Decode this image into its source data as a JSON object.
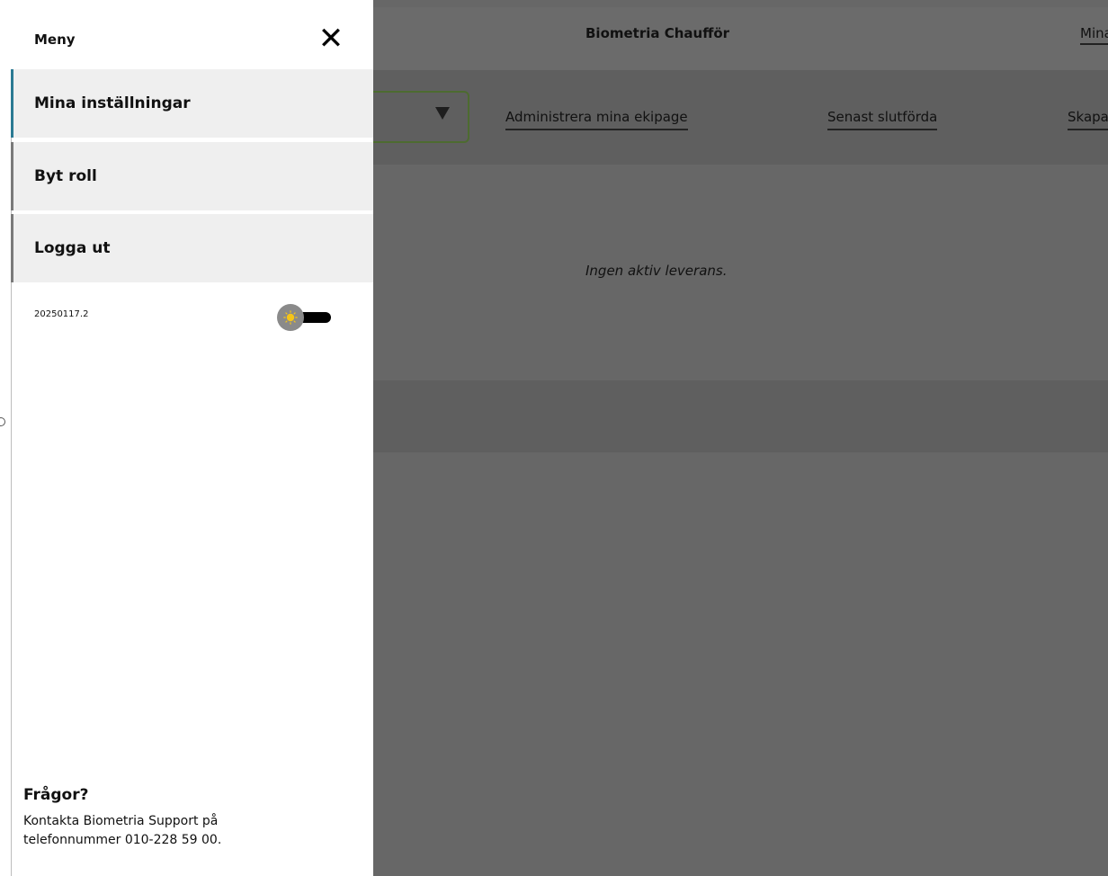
{
  "app": {
    "title": "Biometria Chaufför",
    "header_link": "Mina sidor",
    "subnav": {
      "links": [
        "Administrera mina ekipage",
        "Senast slutförda",
        "Skapa"
      ]
    },
    "empty_message": "Ingen aktiv leverans."
  },
  "drawer": {
    "title": "Meny",
    "close_icon": "close-icon",
    "items": [
      {
        "label": "Mina inställningar"
      },
      {
        "label": "Byt roll"
      },
      {
        "label": "Logga ut"
      }
    ],
    "version": "20250117.2",
    "theme_toggle": {
      "icon": "sun-icon",
      "state": "light"
    },
    "questions": {
      "title": "Frågor?",
      "text": "Kontakta Biometria Support på telefonnummer 010-228 59 00."
    }
  },
  "colors": {
    "overlay": "#676767",
    "active_accent": "#2b7a93",
    "select_border": "#4d6b30",
    "sun": "#f5c518"
  }
}
